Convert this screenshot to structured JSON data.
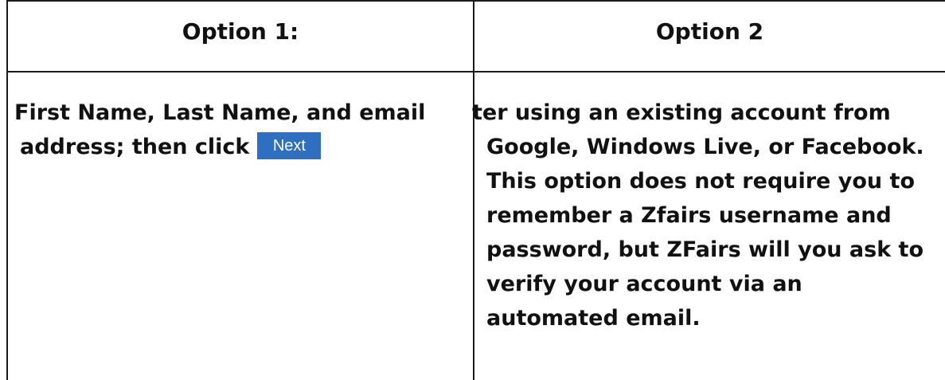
{
  "table": {
    "headers": [
      "Option 1:",
      "Option 2"
    ],
    "option1": {
      "line1": "First Name, Last Name, and email",
      "line2": "address; then click",
      "button_label": "Next"
    },
    "option2": {
      "lines": [
        "ter using an existing account from",
        "Google, Windows Live, or Facebook.",
        "This option does not require you to",
        "remember a Zfairs username and",
        "password, but ZFairs will you ask to",
        "verify your account via an",
        "automated email."
      ]
    }
  },
  "colors": {
    "border": "#1a1a1a",
    "button_bg": "#2f6fbf",
    "button_text": "#ffffff"
  }
}
